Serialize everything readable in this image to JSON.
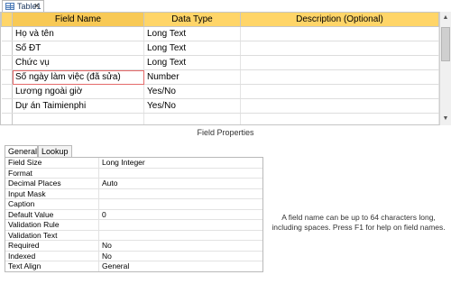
{
  "tab": {
    "title": "Table1",
    "icon": "table-icon",
    "close": "×"
  },
  "grid": {
    "headers": [
      "Field Name",
      "Data Type",
      "Description (Optional)"
    ],
    "rows": [
      {
        "name": "Họ và tên",
        "type": "Long Text",
        "desc": ""
      },
      {
        "name": "Số ĐT",
        "type": "Long Text",
        "desc": ""
      },
      {
        "name": "Chức vụ",
        "type": "Long Text",
        "desc": ""
      },
      {
        "name": "Số ngày làm việc (đã sửa)",
        "type": "Number",
        "desc": ""
      },
      {
        "name": "Lương ngoài giờ",
        "type": "Yes/No",
        "desc": ""
      },
      {
        "name": "Dự án Taimienphi",
        "type": "Yes/No",
        "desc": ""
      },
      {
        "name": "",
        "type": "",
        "desc": ""
      },
      {
        "name": "",
        "type": "",
        "desc": ""
      }
    ]
  },
  "field_properties": {
    "title": "Field Properties",
    "tabs": [
      "General",
      "Lookup"
    ],
    "rows": [
      {
        "key": "Field Size",
        "value": "Long Integer"
      },
      {
        "key": "Format",
        "value": ""
      },
      {
        "key": "Decimal Places",
        "value": "Auto"
      },
      {
        "key": "Input Mask",
        "value": ""
      },
      {
        "key": "Caption",
        "value": ""
      },
      {
        "key": "Default Value",
        "value": "0"
      },
      {
        "key": "Validation Rule",
        "value": ""
      },
      {
        "key": "Validation Text",
        "value": ""
      },
      {
        "key": "Required",
        "value": "No"
      },
      {
        "key": "Indexed",
        "value": "No"
      },
      {
        "key": "Text Align",
        "value": "General"
      }
    ],
    "help": "A field name can be up to 64 characters long, including spaces. Press F1 for help on field names."
  },
  "scrollbar": {
    "up": "▲",
    "down": "▼"
  },
  "colors": {
    "header": "#ffd568",
    "active_outline": "#e46a6a"
  }
}
